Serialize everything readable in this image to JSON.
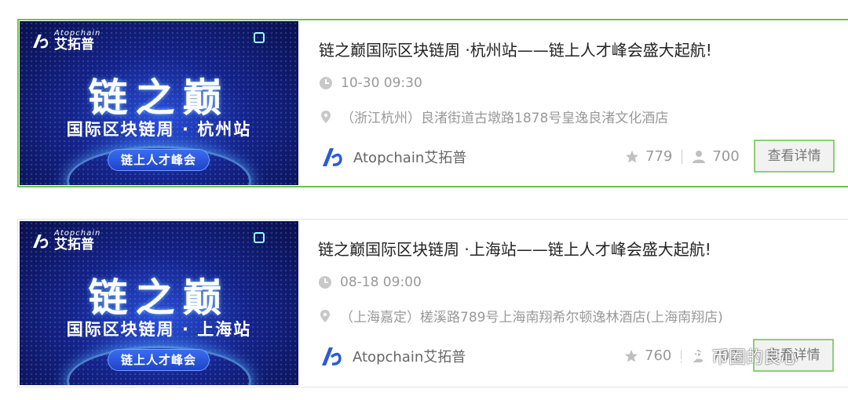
{
  "events": [
    {
      "banner": {
        "brand_sub": "Atopchain",
        "brand_name": "艾拓普",
        "big_title": "链之巅",
        "sub_title": "国际区块链周 · 杭州站",
        "pill": "链上人才峰会"
      },
      "title": "链之巅国际区块链周 ·杭州站——链上人才峰会盛大起航!",
      "time": "10-30 09:30",
      "location": "（浙江杭州）良渚街道古墩路1878号皇逸良渚文化酒店",
      "organizer": "Atopchain艾拓普",
      "stars": "779",
      "attendees": "700",
      "detail_label": "查看详情",
      "active": true
    },
    {
      "banner": {
        "brand_sub": "Atopchain",
        "brand_name": "艾拓普",
        "big_title": "链之巅",
        "sub_title": "国际区块链周 · 上海站",
        "pill": "链上人才峰会"
      },
      "title": "链之巅国际区块链周 ·上海站——链上人才峰会盛大起航!",
      "time": "08-18 09:00",
      "location": "（上海嘉定）槎溪路789号上海南翔希尔顿逸林酒店(上海南翔店)",
      "organizer": "Atopchain艾拓普",
      "stars": "760",
      "attendees": "702",
      "detail_label": "查看详情",
      "active": false
    }
  ],
  "watermark": "币圈的良心",
  "colors": {
    "accent_green": "#6cc24a",
    "brand_blue": "#2a5ad8",
    "muted": "#999999"
  }
}
